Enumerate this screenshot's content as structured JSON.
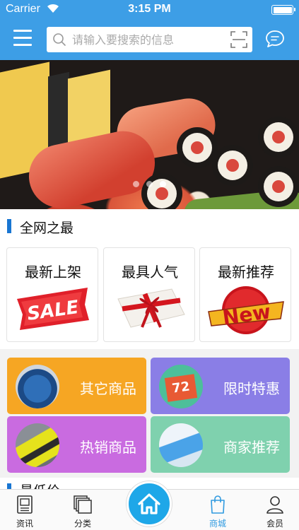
{
  "status_bar": {
    "carrier": "Carrier",
    "time": "3:15 PM"
  },
  "header": {
    "background": "#3d9ee6",
    "search_placeholder": "请输入要搜索的信息",
    "search_value": ""
  },
  "banner": {
    "slide_count": 3,
    "active_slide": 3
  },
  "section_best": {
    "title": "全网之最",
    "cards": [
      {
        "label": "最新上架",
        "image": "SALE"
      },
      {
        "label": "最具人气",
        "image": "gift-box"
      },
      {
        "label": "最新推荐",
        "image": "New"
      }
    ]
  },
  "tiles": [
    {
      "label": "其它商品",
      "color": "#f6a623",
      "image": "backpack"
    },
    {
      "label": "限时特惠",
      "color": "#8a7ee6",
      "image": "calendar"
    },
    {
      "label": "热销商品",
      "color": "#c96be0",
      "image": "sneaker"
    },
    {
      "label": "商家推荐",
      "color": "#7fd1ae",
      "image": "phone"
    }
  ],
  "section_low_price": {
    "title": "最低价"
  },
  "tabbar": {
    "accent": "#2f9ae0",
    "tabs": [
      {
        "label": "资讯",
        "icon": "news-icon"
      },
      {
        "label": "分类",
        "icon": "category-icon"
      },
      {
        "label": "",
        "icon": "home-icon"
      },
      {
        "label": "商城",
        "icon": "shopping-bag-icon",
        "active": true
      },
      {
        "label": "会员",
        "icon": "user-icon"
      }
    ]
  }
}
